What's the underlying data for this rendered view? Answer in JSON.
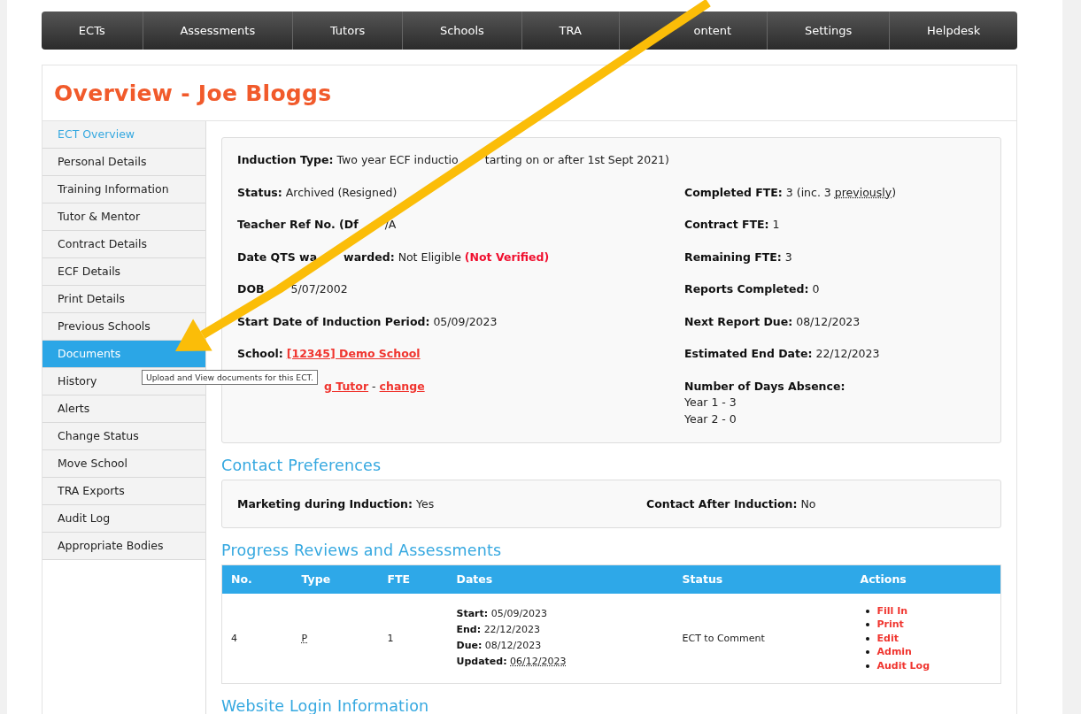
{
  "nav": [
    {
      "label": "ECTs",
      "partial": false
    },
    {
      "label": "Assessments",
      "partial": false
    },
    {
      "label": "Tutors",
      "partial": false
    },
    {
      "label": "Schools",
      "partial": false
    },
    {
      "label": "TRA",
      "partial": false
    },
    {
      "label": "ontent",
      "partial": true
    },
    {
      "label": "Settings",
      "partial": false
    },
    {
      "label": "Helpdesk",
      "partial": false
    }
  ],
  "title": "Overview - Joe Bloggs",
  "sidebar": {
    "items": [
      {
        "label": "ECT Overview",
        "selected": false,
        "current": true
      },
      {
        "label": "Personal Details",
        "selected": false,
        "current": false
      },
      {
        "label": "Training Information",
        "selected": false,
        "current": false
      },
      {
        "label": "Tutor & Mentor",
        "selected": false,
        "current": false
      },
      {
        "label": "Contract Details",
        "selected": false,
        "current": false
      },
      {
        "label": "ECF Details",
        "selected": false,
        "current": false
      },
      {
        "label": "Print Details",
        "selected": false,
        "current": false
      },
      {
        "label": "Previous Schools",
        "selected": false,
        "current": false
      },
      {
        "label": "Documents",
        "selected": true,
        "current": false
      },
      {
        "label": "History",
        "selected": false,
        "current": false
      },
      {
        "label": "Alerts",
        "selected": false,
        "current": false
      },
      {
        "label": "Change Status",
        "selected": false,
        "current": false
      },
      {
        "label": "Move School",
        "selected": false,
        "current": false
      },
      {
        "label": "TRA Exports",
        "selected": false,
        "current": false
      },
      {
        "label": "Audit Log",
        "selected": false,
        "current": false
      },
      {
        "label": "Appropriate Bodies",
        "selected": false,
        "current": false
      }
    ]
  },
  "tooltip": "Upload and View documents for this ECT.",
  "overview": {
    "induction_type": [
      {
        "kind": "label",
        "text": "Induction Type:"
      },
      {
        "kind": "text",
        "text": "Two year ECF inductio"
      },
      {
        "kind": "text",
        "text": "tarting on or after 1st Sept 2021)",
        "gap": true
      }
    ],
    "left": [
      [
        {
          "kind": "label",
          "text": "Status:"
        },
        {
          "kind": "text",
          "text": "Archived (Resigned)"
        }
      ],
      [
        {
          "kind": "label",
          "text": "Teacher Ref No. (Df"
        },
        {
          "kind": "text",
          "text": "/A",
          "gap": true
        }
      ],
      [
        {
          "kind": "label",
          "text": "Date QTS wa"
        },
        {
          "kind": "label",
          "text": "warded:",
          "gap": true
        },
        {
          "kind": "text",
          "text": "Not Eligible"
        },
        {
          "kind": "flag",
          "text": "(Not Verified)"
        }
      ],
      [
        {
          "kind": "label",
          "text": "DOB"
        },
        {
          "kind": "text",
          "text": "5/07/2002",
          "gap": true
        }
      ],
      [
        {
          "kind": "label",
          "text": "Start Date of Induction Period:"
        },
        {
          "kind": "text",
          "text": "05/09/2023"
        }
      ],
      [
        {
          "kind": "label",
          "text": "School:"
        },
        {
          "kind": "link",
          "text": "[12345] Demo School"
        }
      ],
      [
        {
          "kind": "link",
          "text": "g Tutor",
          "gap": true
        },
        {
          "kind": "text",
          "text": "-"
        },
        {
          "kind": "link",
          "text": "change"
        }
      ]
    ],
    "right": [
      [
        {
          "kind": "label",
          "text": "Completed FTE:"
        },
        {
          "kind": "text",
          "text": "3 (inc. 3"
        },
        {
          "kind": "abbr",
          "text": "previously"
        },
        {
          "kind": "close",
          "text": ")"
        }
      ],
      [
        {
          "kind": "label",
          "text": "Contract FTE:"
        },
        {
          "kind": "text",
          "text": "1"
        }
      ],
      [
        {
          "kind": "label",
          "text": "Remaining FTE:"
        },
        {
          "kind": "text",
          "text": "3"
        }
      ],
      [
        {
          "kind": "label",
          "text": "Reports Completed:"
        },
        {
          "kind": "text",
          "text": "0"
        }
      ],
      [
        {
          "kind": "label",
          "text": "Next Report Due:"
        },
        {
          "kind": "text",
          "text": "08/12/2023"
        }
      ],
      [
        {
          "kind": "label",
          "text": "Estimated End Date:"
        },
        {
          "kind": "text",
          "text": "22/12/2023"
        }
      ]
    ],
    "absence": {
      "label": "Number of Days Absence:",
      "lines": [
        "Year 1 - 3",
        "Year 2 - 0"
      ]
    }
  },
  "contact_preferences": {
    "heading": "Contact Preferences",
    "fields": [
      {
        "label": "Marketing during Induction:",
        "value": "Yes"
      },
      {
        "label": "Contact After Induction:",
        "value": "No"
      }
    ]
  },
  "progress": {
    "heading": "Progress Reviews and Assessments",
    "columns": [
      "No.",
      "Type",
      "FTE",
      "Dates",
      "Status",
      "Actions"
    ],
    "rows": [
      {
        "no": "4",
        "type": "P",
        "fte": "1",
        "dates": [
          {
            "label": "Start:",
            "value": "05/09/2023",
            "kind": "text"
          },
          {
            "label": "End:",
            "value": "22/12/2023",
            "kind": "text"
          },
          {
            "label": "Due:",
            "value": "08/12/2023",
            "kind": "text"
          },
          {
            "label": "Updated:",
            "value": "06/12/2023",
            "kind": "abbr"
          }
        ],
        "status": "ECT to Comment",
        "actions": [
          "Fill In",
          "Print",
          "Edit",
          "Admin",
          "Audit Log"
        ]
      }
    ]
  },
  "website_login": {
    "heading": "Website Login Information"
  }
}
